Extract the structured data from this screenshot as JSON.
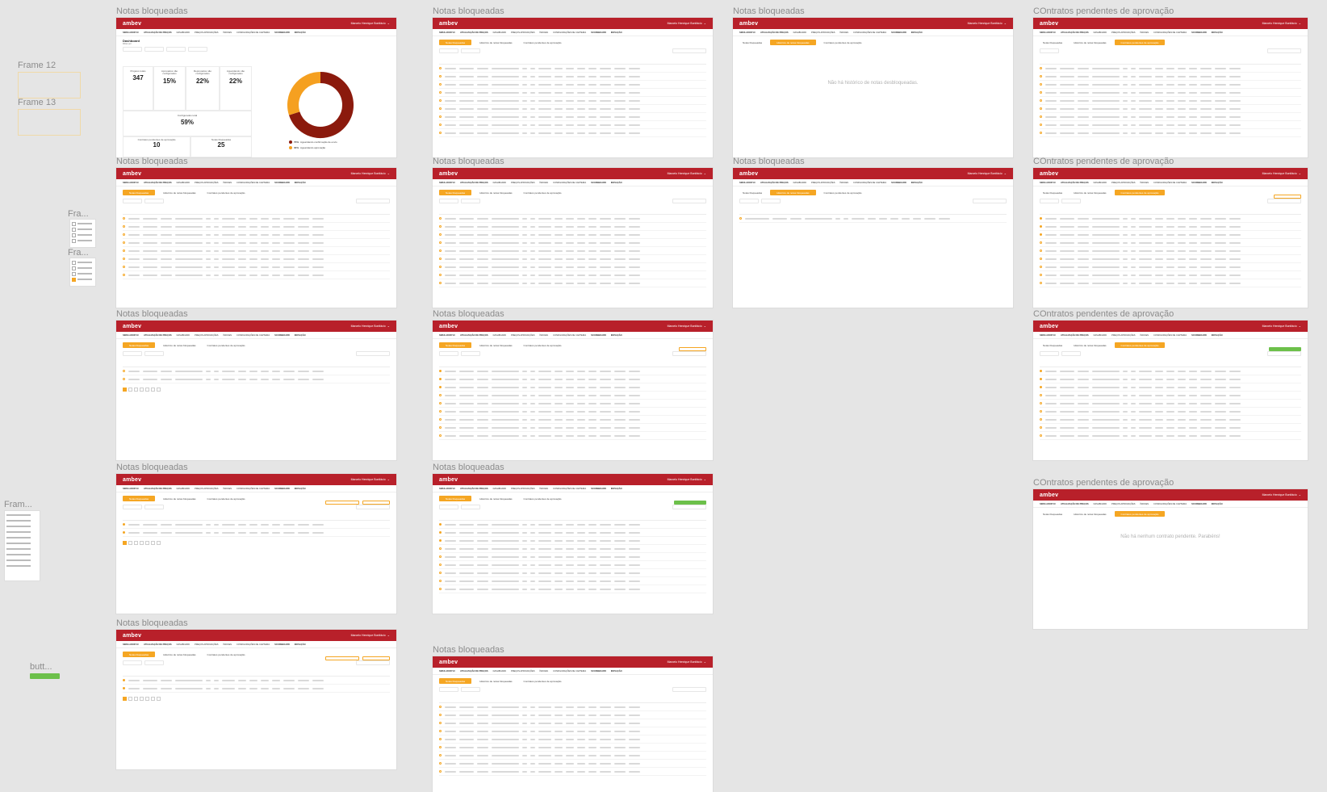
{
  "frame_labels": {
    "notas": "Notas bloqueadas",
    "contratos": "COntratos pendentes de aprovação",
    "frame12": "Frame 12",
    "frame13": "Frame 13",
    "fra1": "Fra...",
    "fra2": "Fra...",
    "fram": "Fram...",
    "butt": "butt..."
  },
  "app": {
    "logo": "ambev",
    "user": "Marcelo Henrique Bonifácio",
    "nav": [
      "Simulador VC",
      "Atualização de preços",
      "Dashboard",
      "Preços Aprovações",
      "Índices",
      "Configurações de carteira",
      "Scoreboard",
      "Inovação"
    ]
  },
  "tabs": {
    "notas": "Notas bloqueadas",
    "historico": "Histórico de notas bloqueadas",
    "contratos": "Contratos pendentes de aprovação"
  },
  "dashboard": {
    "title": "Dashboard",
    "subtitle": "Filtrar por",
    "kpis": [
      {
        "label": "Projetos totais",
        "value": "347"
      },
      {
        "label": "Aprovados não configurados",
        "value": "15%"
      },
      {
        "label": "Reprovados não configurados",
        "value": "22%"
      },
      {
        "label": "Aguardando não configurados",
        "value": "22%"
      },
      {
        "label": "Configurados total",
        "value": "59%"
      },
      {
        "label": "Contratos pendentes de aprovação",
        "value": "10"
      },
      {
        "label": "Notas bloqueadas",
        "value": "25"
      }
    ],
    "donut": {
      "slices": [
        {
          "value": 70,
          "color": "#8b1a0d"
        },
        {
          "value": 30,
          "color": "#f5a020"
        }
      ]
    },
    "legend": [
      {
        "pct": "70%",
        "text": "Aguardando confirmação de envio",
        "color": "#8b1a0d"
      },
      {
        "pct": "30%",
        "text": "Aguardando aprovação",
        "color": "#f5a020"
      }
    ]
  },
  "empty": {
    "historico": "Não há histórico de notas desbloqueadas.",
    "contratos": "Não há nenhum contrato pendente. Parabéns!"
  },
  "colors": {
    "brand": "#b8202a",
    "accent": "#f5a623",
    "success": "#6cc04a"
  }
}
